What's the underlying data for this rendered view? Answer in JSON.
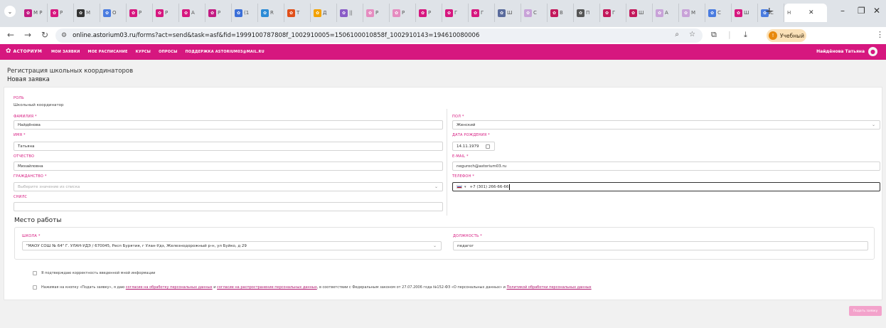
{
  "browser": {
    "tabs": [
      {
        "label": "М Р",
        "color": "#c21b82"
      },
      {
        "label": "Р",
        "color": "#d6177f"
      },
      {
        "label": "М",
        "color": "#333333"
      },
      {
        "label": "О",
        "color": "#4a7ce0"
      },
      {
        "label": "Р",
        "color": "#d6177f"
      },
      {
        "label": "Р",
        "color": "#d6177f"
      },
      {
        "label": "А",
        "color": "#d6177f"
      },
      {
        "label": "Р",
        "color": "#c21b82"
      },
      {
        "label": "(1",
        "color": "#3b6fd8"
      },
      {
        "label": "R",
        "color": "#2c8bd6"
      },
      {
        "label": "Т",
        "color": "#e04f1a"
      },
      {
        "label": "Д",
        "color": "#f3a200"
      },
      {
        "label": "||",
        "color": "#8a5cc7"
      },
      {
        "label": "Р",
        "color": "#e58cc0"
      },
      {
        "label": "Р",
        "color": "#e58cc0"
      },
      {
        "label": "Р",
        "color": "#d6177f"
      },
      {
        "label": "Г",
        "color": "#d6177f"
      },
      {
        "label": "Г",
        "color": "#d6177f"
      },
      {
        "label": "Ш",
        "color": "#5a6b9c"
      },
      {
        "label": "С",
        "color": "#c8a2d8"
      },
      {
        "label": "В",
        "color": "#c2185b"
      },
      {
        "label": "П",
        "color": "#555555"
      },
      {
        "label": "Г",
        "color": "#c2185b"
      },
      {
        "label": "Ш",
        "color": "#c2185b"
      },
      {
        "label": "А",
        "color": "#c8a2d8"
      },
      {
        "label": "М",
        "color": "#c8a2d8"
      },
      {
        "label": "С",
        "color": "#4a7ce0"
      },
      {
        "label": "Ш",
        "color": "#d6177f"
      },
      {
        "label": "С",
        "color": "#4a7ce0"
      }
    ],
    "active_tab": {
      "label": "Н",
      "close": "✕"
    },
    "new_tab": "+",
    "url_host": "online.astorium03.ru",
    "url_rest": "/forms?act=send&task=asf&fid=1999100787808f_1002910005=1506100010858f_1002910143=194610080006",
    "profile_initial": "!",
    "profile_name": "Учебный"
  },
  "header": {
    "logo_text": "АСТОРИУМ",
    "menu": [
      "МОИ ЗАЯВКИ",
      "МОЕ РАСПИСАНИЕ",
      "КУРСЫ",
      "ОПРОСЫ",
      "ПОДДЕРЖКА ASTORIUM03@MAIL.RU"
    ],
    "user_name": "Найдёнова Татьяна"
  },
  "page": {
    "breadcrumb": "Регистрация школьных координаторов",
    "title": "Новая заявка"
  },
  "form": {
    "role": {
      "label": "РОЛЬ",
      "value": "Школьный координатор"
    },
    "surname": {
      "label": "ФАМИЛИЯ",
      "value": "Найдёнова"
    },
    "name": {
      "label": "ИМЯ",
      "value": "Татьяна"
    },
    "patronymic": {
      "label": "ОТЧЕСТВО",
      "value": "Михайловна"
    },
    "citizenship": {
      "label": "ГРАЖДАНСТВО",
      "placeholder": "Выберите значение из списка"
    },
    "snils": {
      "label": "СНИЛС",
      "value": ""
    },
    "gender": {
      "label": "ПОЛ",
      "value": "Женский"
    },
    "birthdate": {
      "label": "ДАТА РОЖДЕНИЯ",
      "value": "14.11.1979"
    },
    "email": {
      "label": "E-MAIL",
      "value": "neguroch@astorium03.ru"
    },
    "phone": {
      "label": "ТЕЛЕФОН",
      "value": "+7 (301) 266-66-66"
    },
    "required_mark": "*"
  },
  "workplace": {
    "title": "Место работы",
    "school": {
      "label": "ШКОЛА",
      "value": "\"МАОУ СОШ № 64\" Г. УЛАН-УДЭ / 670045, Респ Бурятия, г Улан-Удэ, Железнодорожный р-н, ул Буйко, д 29"
    },
    "position": {
      "label": "ДОЛЖНОСТЬ",
      "value": "педагог"
    }
  },
  "consent": {
    "confirm_text": "Я подтверждаю корректность введенной мной информации",
    "agree_prefix": "Нажимая на кнопку «Подать заявку», я даю",
    "link1": "согласие на обработку персональных данных",
    "and1": "и",
    "link2": "согласие на распространение персональных данных",
    "middle": ", в соответствии с Федеральным законом от 27.07.2006 года №152-ФЗ «О персональных данных» и",
    "link3": "Политикой обработки персональных данных"
  },
  "submit_label": "Подать заявку"
}
